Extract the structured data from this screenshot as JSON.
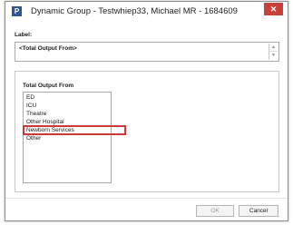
{
  "window": {
    "app_icon": "P",
    "title": "Dynamic Group - Testwhiep33, Michael   MR - 1684609",
    "close_glyph": "✕"
  },
  "label_section": {
    "heading": "Label:",
    "value": "<Total Output From>"
  },
  "total_output": {
    "heading": "Total Output From",
    "items": [
      {
        "label": "ED"
      },
      {
        "label": "ICU"
      },
      {
        "label": "Theatre"
      },
      {
        "label": "Other Hospital"
      },
      {
        "label": "Newborn Services"
      },
      {
        "label": "Other"
      }
    ],
    "highlighted_item": "Newborn Services"
  },
  "buttons": {
    "ok": "OK",
    "cancel": "Cancel"
  },
  "colors": {
    "close_button": "#c7403a",
    "highlight_border": "#d0393b",
    "app_icon": "#2b5797"
  }
}
